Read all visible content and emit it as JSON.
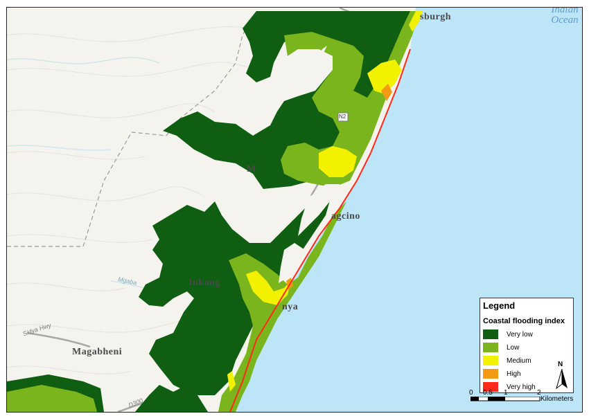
{
  "colors": {
    "land": "#f4f3ee",
    "ocean": "#bde5f8",
    "very_low": "#0f5e12",
    "low": "#7ab51d",
    "medium": "#f2f200",
    "high": "#f39a12",
    "very_high": "#ff2a1a",
    "road": "#a0a0a0",
    "boundary": "#999999"
  },
  "places": {
    "ballito_partial": "sburgh",
    "mgcino_partial": "agcino",
    "m_partial": "M",
    "inkanga_partial": "Inkang",
    "nyaya_partial": "nya",
    "magabheni": "Magabheni"
  },
  "ocean_label": {
    "line1": "Indian",
    "line2": "Ocean"
  },
  "roads": {
    "sidya": "Sidya Hwy",
    "d300": "D300",
    "n2": "N2"
  },
  "rivers": {
    "mgababa": "Mgaba"
  },
  "legend": {
    "title": "Legend",
    "subtitle": "Coastal flooding index",
    "items": [
      {
        "label": "Very low",
        "color": "#0f5e12"
      },
      {
        "label": "Low",
        "color": "#7ab51d"
      },
      {
        "label": "Medium",
        "color": "#f2f200"
      },
      {
        "label": "High",
        "color": "#f39a12"
      },
      {
        "label": "Very high",
        "color": "#ff2a1a"
      }
    ],
    "north_label": "N"
  },
  "scale": {
    "ticks": [
      "0",
      "0.5",
      "1",
      "2"
    ],
    "unit": "Kilometers"
  }
}
